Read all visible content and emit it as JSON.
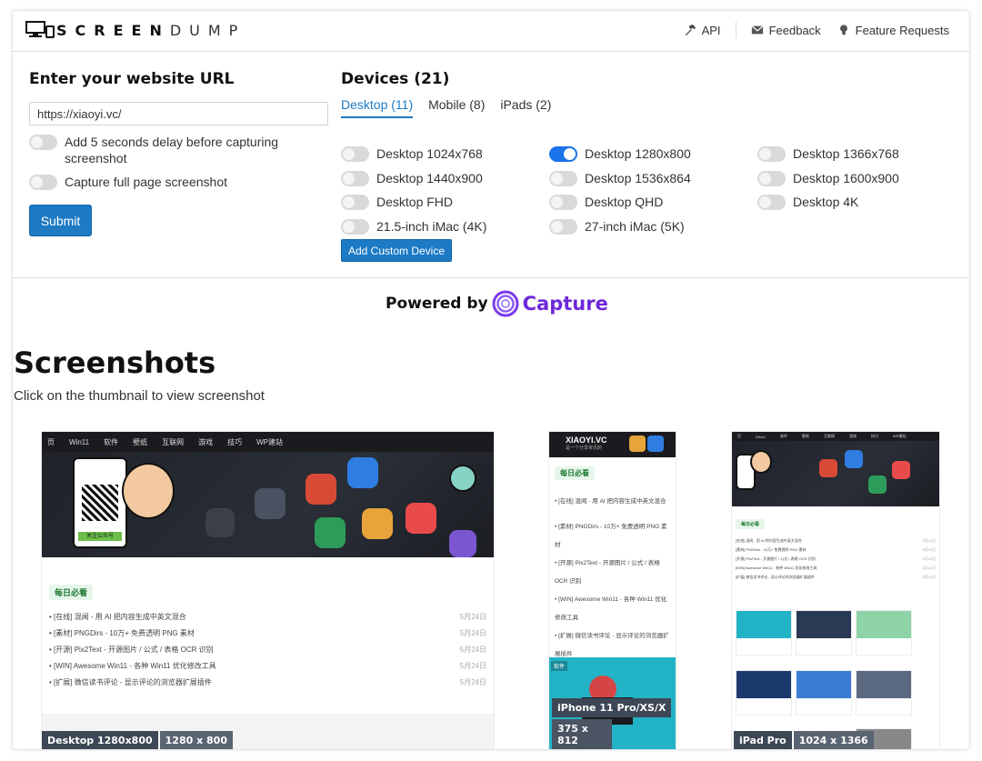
{
  "brand": {
    "bold": "SCREEN",
    "light": "DUMP"
  },
  "nav": {
    "api": "API",
    "feedback": "Feedback",
    "feature_requests": "Feature Requests"
  },
  "form": {
    "heading": "Enter your website URL",
    "url_value": "https://xiaoyi.vc/",
    "delay_label": "Add 5 seconds delay before capturing screenshot",
    "fullpage_label": "Capture full page screenshot",
    "submit_label": "Submit"
  },
  "devices": {
    "heading": "Devices (21)",
    "tabs": [
      {
        "label": "Desktop (11)",
        "active": true
      },
      {
        "label": "Mobile (8)",
        "active": false
      },
      {
        "label": "iPads (2)",
        "active": false
      }
    ],
    "items": [
      {
        "label": "Desktop 1024x768",
        "on": false
      },
      {
        "label": "Desktop 1280x800",
        "on": true
      },
      {
        "label": "Desktop 1366x768",
        "on": false
      },
      {
        "label": "Desktop 1440x900",
        "on": false
      },
      {
        "label": "Desktop 1536x864",
        "on": false
      },
      {
        "label": "Desktop 1600x900",
        "on": false
      },
      {
        "label": "Desktop FHD",
        "on": false
      },
      {
        "label": "Desktop QHD",
        "on": false
      },
      {
        "label": "Desktop 4K",
        "on": false
      },
      {
        "label": "21.5-inch iMac (4K)",
        "on": false
      },
      {
        "label": "27-inch iMac (5K)",
        "on": false
      }
    ],
    "custom_label": "Add Custom Device"
  },
  "powered": {
    "prefix": "Powered by",
    "name": "Capture"
  },
  "screenshots": {
    "title": "Screenshots",
    "subtitle": "Click on the thumbnail to view screenshot",
    "thumbs": [
      {
        "device": "Desktop 1280x800",
        "size": "1280 x 800"
      },
      {
        "device": "iPhone 11 Pro/XS/X",
        "size": "375 x 812"
      },
      {
        "device": "iPad Pro",
        "size": "1024 x 1366"
      }
    ]
  },
  "site": {
    "nav": [
      "页",
      "Win11",
      "软件",
      "壁纸",
      "互联网",
      "游戏",
      "技巧",
      "WP建站"
    ],
    "logo": "XIAOYI.VC",
    "logo_sub": "是一个分享资讯的",
    "section_tag": "每日必看",
    "qr_caption": "关注公众号",
    "list_items": [
      "[在线] 混闻 - 用 AI 把内容生成中英文混合",
      "[素材] PNGDirs - 10万+ 免费透明 PNG 素材",
      "[开源] Pix2Text - 开源图片 / 公式 / 表格 OCR 识别",
      "[WIN] Awesome Win11 - 各种 Win11 优化修改工具",
      "[扩展] 微信读书评论 - 显示评论的浏览器扩展插件"
    ],
    "list_date": "5月24日",
    "category_tag": "软件"
  },
  "colors": {
    "accent": "#1d7ac4",
    "capture": "#6d28d9",
    "toggle_on": "#1a73e8"
  }
}
